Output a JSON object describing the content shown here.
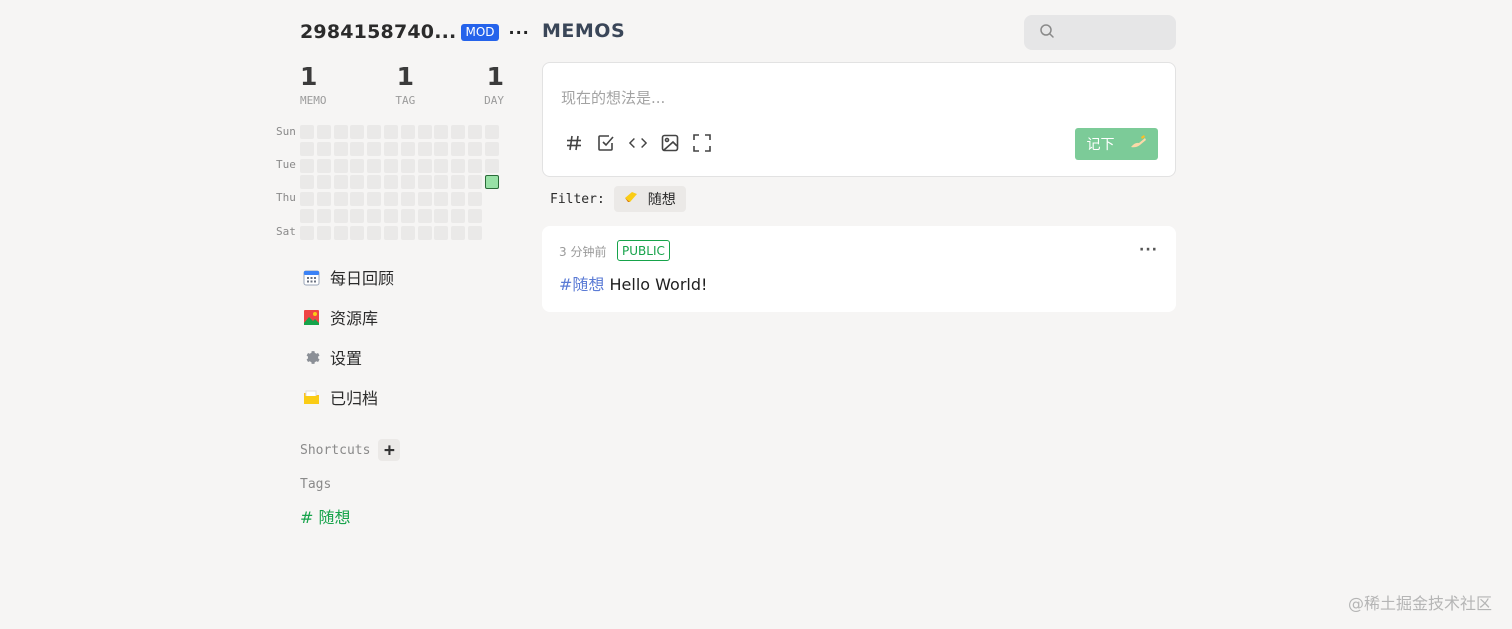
{
  "user": {
    "name": "2984158740...",
    "role_badge": "MOD",
    "menu_label": "···"
  },
  "stats": [
    {
      "value": "1",
      "label": "MEMO"
    },
    {
      "value": "1",
      "label": "TAG"
    },
    {
      "value": "1",
      "label": "DAY"
    }
  ],
  "heatmap": {
    "day_labels": [
      "Sun",
      "Tue",
      "Thu",
      "Sat"
    ],
    "weeks": 12,
    "days_per_week": 7,
    "last_week_days": 3,
    "active_week": 11,
    "active_day": 3,
    "colors": {
      "empty": "#eae9e8",
      "active": "#98e1a6"
    }
  },
  "nav": [
    {
      "label": "每日回顾",
      "icon": "calendar-icon"
    },
    {
      "label": "资源库",
      "icon": "picture-icon"
    },
    {
      "label": "设置",
      "icon": "gear-icon"
    },
    {
      "label": "已归档",
      "icon": "folder-icon"
    }
  ],
  "shortcuts": {
    "title": "Shortcuts",
    "add_label": "+"
  },
  "tags": {
    "title": "Tags",
    "items": [
      "# 随想"
    ]
  },
  "main": {
    "title": "MEMOS",
    "search_placeholder": "",
    "editor": {
      "placeholder": "现在的想法是...",
      "submit_label": "记下",
      "toolbar": [
        "hash-icon",
        "checkbox-icon",
        "code-icon",
        "image-icon",
        "fullscreen-icon"
      ]
    },
    "filter": {
      "label": "Filter:",
      "chip": "随想"
    },
    "memo": {
      "time": "3 分钟前",
      "visibility": "PUBLIC",
      "tag": "#随想",
      "text": " Hello World!",
      "menu_label": "···"
    }
  },
  "colors": {
    "accent_green": "#16a34a",
    "button_green": "#7ccb98",
    "mod_blue": "#2563eb",
    "tag_blue": "#5b7bd5"
  },
  "watermark": "@稀土掘金技术社区"
}
